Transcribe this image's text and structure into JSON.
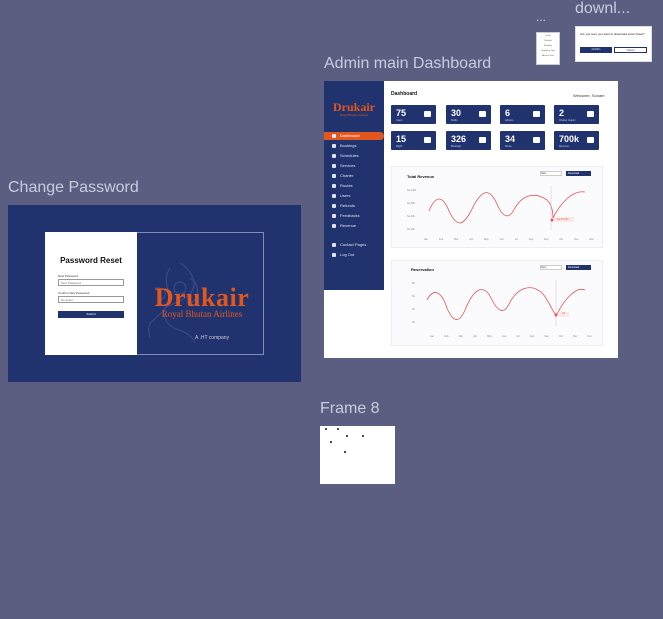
{
  "frames": {
    "change_password": "Change Password",
    "admin_dashboard": "Admin main Dashboard",
    "frame8": "Frame 8",
    "download": "downl...",
    "ellipsis": "..."
  },
  "password_reset": {
    "title": "Password Reset",
    "new_password_label": "New Password",
    "new_password_placeholder": "New Password",
    "confirm_label": "Confirm New Password",
    "confirm_placeholder": "Re-Enter",
    "submit": "Submit",
    "logo": "Drukair",
    "logo_sub": "Royal Bhutan Airlines",
    "tagline": "A .HT company"
  },
  "dashboard": {
    "title": "Dashboard",
    "welcome": "Welcome, Sonam",
    "logo": "Drukair",
    "logo_sub": "Royal Bhutan Airlines",
    "sidebar": [
      {
        "label": "Dashboard",
        "active": true
      },
      {
        "label": "Bookings"
      },
      {
        "label": "Schedules"
      },
      {
        "label": "Services"
      },
      {
        "label": "Charter"
      },
      {
        "label": "Routes"
      },
      {
        "label": "Users"
      },
      {
        "label": "Refunds"
      },
      {
        "label": "Feedbacks"
      },
      {
        "label": "Revenue"
      }
    ],
    "sidebar_bottom": [
      {
        "label": "Contact Pages"
      },
      {
        "label": "Log Out"
      }
    ],
    "stats": [
      {
        "value": "75",
        "caption": "Users"
      },
      {
        "value": "30",
        "caption": "Staffs"
      },
      {
        "value": "6",
        "caption": "Admins"
      },
      {
        "value": "2",
        "caption": "Charter Inquiry"
      },
      {
        "value": "15",
        "caption": "Flight"
      },
      {
        "value": "326",
        "caption": "Bookings"
      },
      {
        "value": "34",
        "caption": "Route"
      },
      {
        "value": "700k",
        "caption": "Revenue"
      }
    ],
    "revenue_panel": {
      "title": "Total Revenue",
      "filter": "Date",
      "download": "Download",
      "y_ticks": [
        "Nu.100k",
        "Nu.80k",
        "Nu.40k",
        "Nu.20k"
      ],
      "months": [
        "Jan",
        "Feb",
        "Mar",
        "Apr",
        "May",
        "Jun",
        "Jul",
        "Aug",
        "Sep",
        "Oct",
        "Nov",
        "Dec"
      ],
      "marker_label": "Nu.84,000"
    },
    "reservation_panel": {
      "title": "Reservation",
      "filter": "Date",
      "download": "Download",
      "y_ticks": [
        "80",
        "60",
        "40",
        "20"
      ],
      "months": [
        "Jan",
        "Feb",
        "Mar",
        "Apr",
        "May",
        "Jun",
        "Jul",
        "Aug",
        "Sep",
        "Oct",
        "Nov",
        "Dec"
      ],
      "marker_label": "34"
    }
  },
  "dialog": {
    "message": "Are you sure you want to download excel sheet?",
    "confirm": "Confirm",
    "cancel": "Cancel"
  },
  "mini_menu": [
    "Daily",
    "Weekly",
    "Monthly",
    "Quarterly Year",
    "Annual Year"
  ]
}
